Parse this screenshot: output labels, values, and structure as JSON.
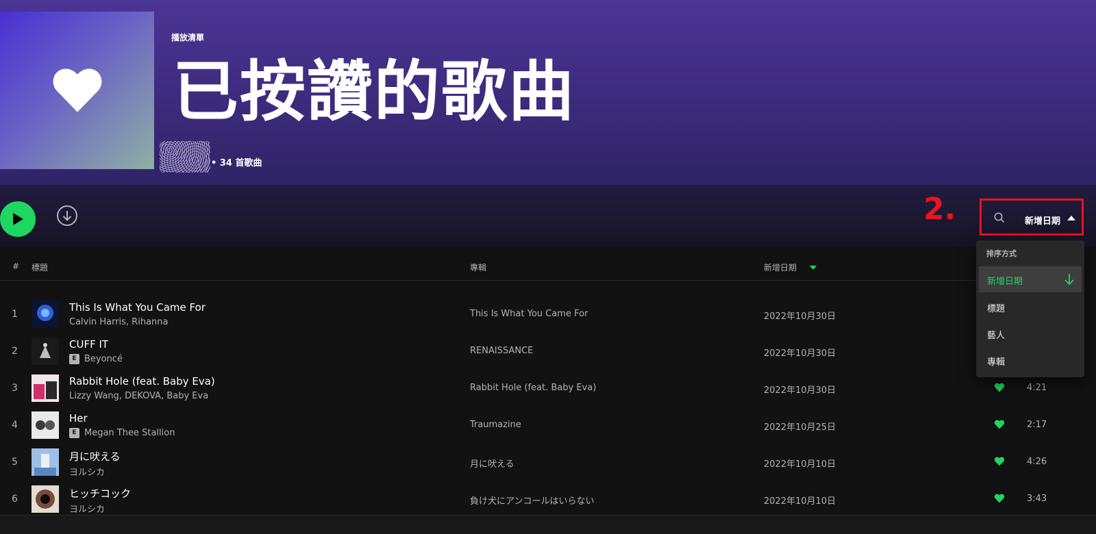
{
  "header": {
    "kind": "播放清單",
    "title": "已按讚的歌曲",
    "count": "• 34 首歌曲"
  },
  "toolbar": {
    "step_label": "2.",
    "sort_label": "新增日期"
  },
  "columns": {
    "index": "#",
    "title": "標題",
    "album": "專輯",
    "date_added": "新增日期"
  },
  "tracks": [
    {
      "num": "1",
      "title": "This Is What You Came For",
      "artist": "Calvin Harris, Rihanna",
      "explicit": false,
      "album": "This Is What You Came For",
      "added": "2022年10月30日",
      "duration": ""
    },
    {
      "num": "2",
      "title": "CUFF IT",
      "artist": "Beyoncé",
      "explicit": true,
      "album": "RENAISSANCE",
      "added": "2022年10月30日",
      "duration": ""
    },
    {
      "num": "3",
      "title": "Rabbit Hole (feat. Baby Eva)",
      "artist": "Lizzy Wang, DEKOVA, Baby Eva",
      "explicit": false,
      "album": "Rabbit Hole (feat. Baby Eva)",
      "added": "2022年10月30日",
      "duration": "4:21"
    },
    {
      "num": "4",
      "title": "Her",
      "artist": "Megan Thee Stallion",
      "explicit": true,
      "album": "Traumazine",
      "added": "2022年10月25日",
      "duration": "2:17"
    },
    {
      "num": "5",
      "title": "月に吠える",
      "artist": "ヨルシカ",
      "explicit": false,
      "album": "月に吠える",
      "added": "2022年10月10日",
      "duration": "4:26"
    },
    {
      "num": "6",
      "title": "ヒッチコック",
      "artist": "ヨルシカ",
      "explicit": false,
      "album": "負け犬にアンコールはいらない",
      "added": "2022年10月10日",
      "duration": "3:43"
    }
  ],
  "explicit_badge": "E",
  "sort_menu": {
    "title": "排序方式",
    "items": [
      "新增日期",
      "標題",
      "藝人",
      "專輯"
    ],
    "active": "新增日期"
  },
  "colors": {
    "accent": "#1ed760",
    "annotation": "#e8141f",
    "hero": "#4b3595"
  }
}
